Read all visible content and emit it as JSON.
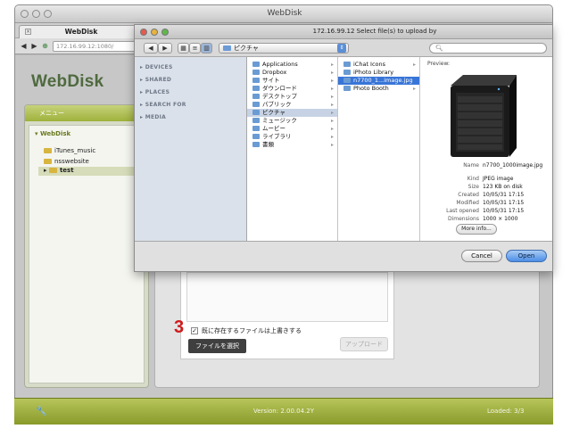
{
  "browser": {
    "window_title": "WebDisk",
    "tab_title": "WebDisk",
    "url": "172.16.99.12:1080/"
  },
  "webdisk": {
    "logo": "WebDisk",
    "menu_header": "メニュー",
    "tree": {
      "root": "WebDisk",
      "items": [
        "iTunes_music",
        "nsswebsite",
        "test"
      ]
    },
    "upload": {
      "step_number": "3",
      "overwrite_label": "既に存在するファイルは上書きする",
      "choose_file": "ファイルを選択",
      "upload_button": "アップロード"
    },
    "footer": {
      "version": "Version: 2.00.04.2Y",
      "loaded": "Loaded: 3/3"
    }
  },
  "dialog": {
    "title": "172.16.99.12 Select file(s) to upload by",
    "location": "ピクチャ",
    "search_placeholder": "",
    "sidebar": [
      "DEVICES",
      "SHARED",
      "PLACES",
      "SEARCH FOR",
      "MEDIA"
    ],
    "column1": [
      {
        "label": "Applications",
        "arrow": true
      },
      {
        "label": "Dropbox",
        "arrow": true
      },
      {
        "label": "サイト",
        "arrow": true
      },
      {
        "label": "ダウンロード",
        "arrow": true
      },
      {
        "label": "デスクトップ",
        "arrow": true
      },
      {
        "label": "パブリック",
        "arrow": true
      },
      {
        "label": "ピクチャ",
        "arrow": true,
        "selected": true
      },
      {
        "label": "ミュージック",
        "arrow": true
      },
      {
        "label": "ムービー",
        "arrow": true
      },
      {
        "label": "ライブラリ",
        "arrow": true
      },
      {
        "label": "書類",
        "arrow": true
      }
    ],
    "column2": [
      {
        "label": "iChat Icons",
        "arrow": true
      },
      {
        "label": "iPhoto Library",
        "arrow": false
      },
      {
        "label": "n7700_1...image.jpg",
        "arrow": false,
        "selected": true
      },
      {
        "label": "Photo Booth",
        "arrow": true
      }
    ],
    "preview": {
      "header": "Preview:",
      "meta": [
        {
          "key": "Name",
          "value": "n7700_1000image.jpg"
        },
        {
          "key": "Kind",
          "value": "JPEG image"
        },
        {
          "key": "Size",
          "value": "123 KB on disk"
        },
        {
          "key": "Created",
          "value": "10/05/31 17:15"
        },
        {
          "key": "Modified",
          "value": "10/05/31 17:15"
        },
        {
          "key": "Last opened",
          "value": "10/05/31 17:15"
        },
        {
          "key": "Dimensions",
          "value": "1000 × 1000"
        }
      ],
      "more_info": "More info..."
    },
    "cancel": "Cancel",
    "open": "Open"
  }
}
